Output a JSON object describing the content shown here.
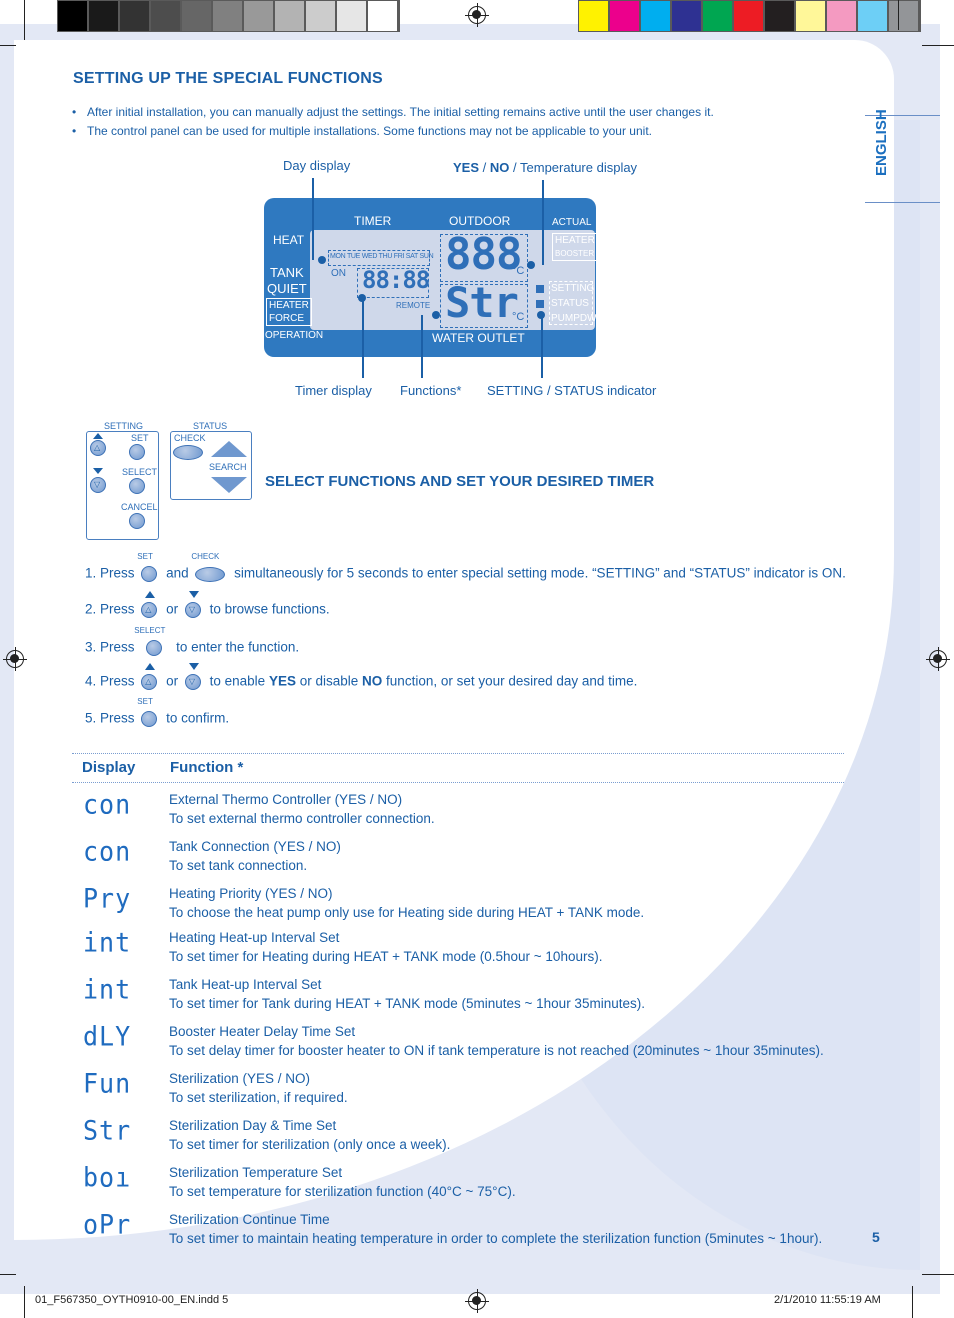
{
  "print_marks": {
    "gray_swatches": [
      "#000000",
      "#1a1a1a",
      "#333333",
      "#4d4d4d",
      "#666666",
      "#808080",
      "#999999",
      "#b3b3b3",
      "#cccccc",
      "#e6e6e6",
      "#ffffff"
    ],
    "color_swatches": [
      "#fff200",
      "#ec008c",
      "#00aeef",
      "#2e3192",
      "#00a651",
      "#ed1c24",
      "#231f20",
      "#fff799",
      "#f49ac1",
      "#6dcff6",
      "#939598"
    ]
  },
  "header": {
    "title": "SETTING UP THE SPECIAL FUNCTIONS",
    "bullets": [
      "After initial installation, you can manually adjust the settings. The initial setting remains active until the user changes it.",
      "The control panel can be used for multiple installations. Some functions may not be applicable to your unit."
    ],
    "language_tab": "ENGLISH"
  },
  "lcd_diagram": {
    "callouts": {
      "day_display": "Day display",
      "yes": "YES",
      "no": "NO",
      "temp_display_suffix": "/ Temperature display",
      "slash": "/",
      "timer_display": "Timer display",
      "functions": "Functions*",
      "setting_status": "SETTING / STATUS indicator"
    },
    "panel_labels": {
      "timer": "TIMER",
      "outdoor": "OUTDOOR",
      "actual": "ACTUAL",
      "heater_booster_1": "HEATER",
      "heater_booster_2": "BOOSTER",
      "heat": "HEAT",
      "tank": "TANK",
      "quiet": "QUIET",
      "heater_force_1": "HEATER",
      "heater_force_2": "FORCE",
      "operation": "OPERATION",
      "water_outlet": "WATER OUTLET",
      "setting": "SETTING",
      "status": "STATUS",
      "pumpdw": "PUMPDW",
      "days": "MON TUE WED THU FRI  SAT SUN",
      "on": "ON",
      "time_digits": "88:88",
      "remote": "REMOTE",
      "temp_digits": "888",
      "func_digits": "Str",
      "unit": "°C"
    }
  },
  "button_pad": {
    "setting_label": "SETTING",
    "status_label": "STATUS",
    "set": "SET",
    "select": "SELECT",
    "cancel": "CANCEL",
    "check": "CHECK",
    "search": "SEARCH"
  },
  "subheading": "SELECT FUNCTIONS AND SET YOUR DESIRED TIMER",
  "steps": {
    "s1": {
      "num": "1. Press",
      "btn1": "SET",
      "and": "and",
      "btn2": "CHECK",
      "text": "simultaneously for 5 seconds to enter special setting mode. “SETTING” and “STATUS” indicator is ON."
    },
    "s2": {
      "num": "2. Press",
      "or": "or",
      "text": "to browse functions."
    },
    "s3": {
      "num": "3. Press",
      "btn": "SELECT",
      "text": "to enter the function."
    },
    "s4": {
      "num": "4. Press",
      "or": "or",
      "t1": "to enable",
      "yes": "YES",
      "t2": "or disable",
      "no": "NO",
      "t3": "function, or set your desired day and time."
    },
    "s5": {
      "num": "5. Press",
      "btn": "SET",
      "text": "to confirm."
    }
  },
  "table": {
    "col_display": "Display",
    "col_function": "Function *",
    "rows": [
      {
        "code": "con",
        "title": "External Thermo Controller (YES / NO)",
        "desc": "To set external thermo controller connection."
      },
      {
        "code": "con",
        "title": "Tank Connection (YES / NO)",
        "desc": "To set tank connection."
      },
      {
        "code": "Pry",
        "title": "Heating Priority (YES / NO)",
        "desc": "To choose the heat pump only use for Heating side during HEAT + TANK mode."
      },
      {
        "code": "int",
        "title": "Heating Heat-up Interval Set",
        "desc": "To set timer for Heating during HEAT + TANK mode (0.5hour ~ 10hours)."
      },
      {
        "code": "int",
        "title": "Tank Heat-up Interval Set",
        "desc": "To set timer for Tank during HEAT + TANK mode (5minutes ~ 1hour 35minutes)."
      },
      {
        "code": "dLY",
        "title": "Booster Heater Delay Time Set",
        "desc": "To set delay timer for booster heater to ON if tank temperature is not reached (20minutes ~ 1hour 35minutes)."
      },
      {
        "code": "Fun",
        "title": "Sterilization (YES / NO)",
        "desc": "To set sterilization, if required."
      },
      {
        "code": "Str",
        "title": "Sterilization Day & Time Set",
        "desc": "To set timer for sterilization (only once a week)."
      },
      {
        "code": "boı",
        "title": "Sterilization Temperature Set",
        "desc": "To set temperature for sterilization function (40°C ~ 75°C)."
      },
      {
        "code": "oPr",
        "title": "Sterilization Continue Time",
        "desc": "To set timer to maintain heating temperature in order to complete the sterilization function (5minutes ~ 1hour)."
      }
    ]
  },
  "page_number": "5",
  "footer": {
    "file": "01_F567350_OYTH0910-00_EN.indd   5",
    "timestamp": "2/1/2010   11:55:19 AM"
  }
}
